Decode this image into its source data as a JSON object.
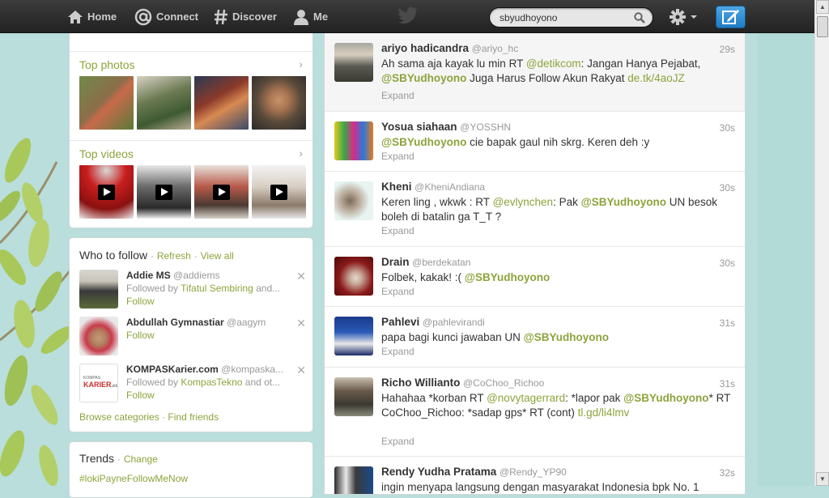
{
  "nav": {
    "home": "Home",
    "connect": "Connect",
    "discover": "Discover",
    "me": "Me"
  },
  "search": {
    "value": "sbyudhoyono"
  },
  "media": {
    "top_photos": "Top photos",
    "top_videos": "Top videos"
  },
  "who_to_follow": {
    "title": "Who to follow",
    "separator": "·",
    "refresh": "Refresh",
    "view_all": "View all",
    "suggestions": [
      {
        "name": "Addie MS",
        "handle": "@addiems",
        "followed_prefix": "Followed by",
        "followed_name": "Tifatul Sembiring",
        "followed_suffix": "and...",
        "follow": "Follow"
      },
      {
        "name": "Abdullah Gymnastiar",
        "handle": "@aagym",
        "followed_prefix": "",
        "followed_name": "",
        "followed_suffix": "",
        "follow": "Follow"
      },
      {
        "name": "KOMPASKarier.com",
        "handle": "@kompaska...",
        "followed_prefix": "Followed by",
        "followed_name": "KompasTekno",
        "followed_suffix": "and ot...",
        "follow": "Follow"
      }
    ],
    "browse_categories": "Browse categories",
    "find_friends": "Find friends",
    "logo_text": "KOMPAS KARIER.com"
  },
  "trends": {
    "title": "Trends",
    "change": "Change",
    "items": [
      "#lokiPayneFollowMeNow"
    ]
  },
  "tweets": [
    {
      "name": "ariyo hadicandra",
      "handle": "@ariyo_hc",
      "time": "29s",
      "expand": "Expand"
    },
    {
      "name": "Yosua siahaan",
      "handle": "@YOSSHN",
      "time": "30s",
      "expand": "Expand"
    },
    {
      "name": "Kheni",
      "handle": "@KheniAndiana",
      "time": "30s",
      "expand": "Expand"
    },
    {
      "name": "Drain",
      "handle": "@berdekatan",
      "time": "30s",
      "expand": "Expand"
    },
    {
      "name": "Pahlevi",
      "handle": "@pahlevirandi",
      "time": "31s",
      "expand": "Expand"
    },
    {
      "name": "Richo Williantо",
      "handle": "@CoChoo_Richoo",
      "time": "31s",
      "expand": "Expand"
    },
    {
      "name": "Rendy Yudha Pratama",
      "handle": "@Rendy_YP90",
      "time": "32s",
      "expand": ""
    }
  ],
  "tweet_text": {
    "t0": {
      "a": "Ah sama aja kayak lu min RT ",
      "m1": "@detikcom",
      "b": ": Jangan Hanya Pejabat, ",
      "m2": "@SBYudhoyono",
      "c": " Juga Harus Follow Akun Rakyat ",
      "link": "de.tk/4aoJZ"
    },
    "t1": {
      "m1": "@SBYudhoyono",
      "a": " cie bapak gaul nih skrg. Keren deh :y"
    },
    "t2": {
      "a": "Keren ling , wkwk : RT ",
      "m1": "@evlynchen",
      "b": ": Pak ",
      "m2": "@SBYudhoyono",
      "c": " UN besok boleh di batalin ga T_T ?"
    },
    "t3": {
      "a": "Folbek, kakak! :( ",
      "m1": "@SBYudhoyono"
    },
    "t4": {
      "a": "papa bagi kunci jawaban UN ",
      "m1": "@SBYudhoyono"
    },
    "t5": {
      "a": "Hahahaa *korban RT ",
      "m1": "@novytagerrard",
      "b": ": *lapor pak ",
      "m2": "@SBYudhoyono",
      "c": "* RT CoChoo_Richoo: *sadap gps* RT (cont) ",
      "link": "tl.gd/li4lmv"
    },
    "t6": {
      "a": "ingin menyapa langsung dengan masyarakat Indonesia bpk No. 1"
    }
  },
  "colors": {
    "accent": "#8ca43c",
    "topbar": "#2b2b2b",
    "background": "#b9dedb",
    "compose": "#2f8fd8"
  },
  "icons": [
    "home-icon",
    "connect-icon",
    "discover-icon",
    "me-icon",
    "twitter-bird-icon",
    "search-icon",
    "gear-icon",
    "compose-icon",
    "chevron-right-icon",
    "play-icon",
    "close-icon"
  ]
}
